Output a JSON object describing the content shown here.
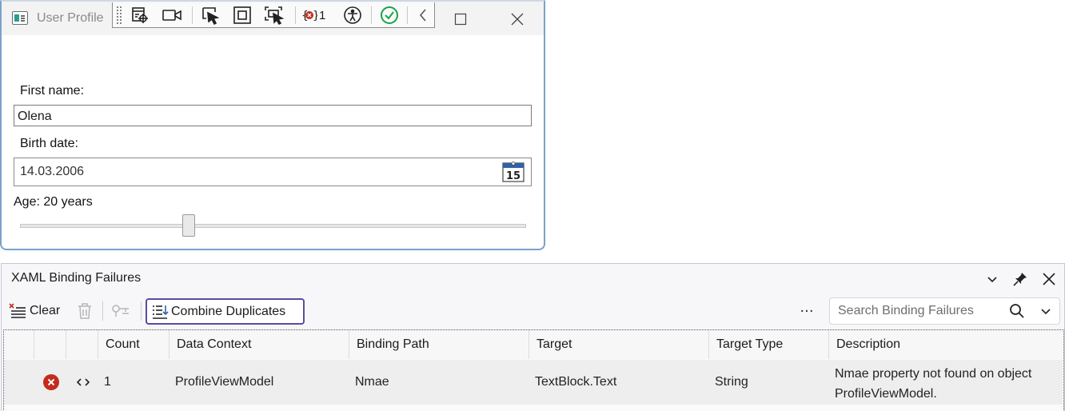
{
  "app_window": {
    "title": "User Profile",
    "runtime_toolbar": {
      "error_count": "1",
      "tools": [
        "go-to-live-visual-tree",
        "show-in-app-toolbar",
        "select-element",
        "display-layout-adorners",
        "track-focused-element",
        "binding-failures",
        "accessibility-checker",
        "hot-reload-status",
        "collapse-toolbar"
      ]
    },
    "form": {
      "first_name_label": "First name:",
      "first_name_value": "Olena",
      "birth_date_label": "Birth date:",
      "birth_date_value": "14.03.2006",
      "calendar_day": "15",
      "age_label": "Age: 20 years",
      "age_slider_fraction": 0.333
    }
  },
  "panel": {
    "title": "XAML Binding Failures",
    "toolbar": {
      "clear_label": "Clear",
      "combine_label": "Combine Duplicates",
      "more_label": "···",
      "search_placeholder": "Search Binding Failures"
    },
    "columns": [
      "Count",
      "Data Context",
      "Binding Path",
      "Target",
      "Target Type",
      "Description"
    ],
    "rows": [
      {
        "count": "1",
        "data_context": "ProfileViewModel",
        "binding_path": "Nmae",
        "target": "TextBlock.Text",
        "target_type": "String",
        "description": "Nmae property not found on object ProfileViewModel."
      }
    ]
  },
  "colors": {
    "accent": "#5a4da0",
    "error": "#c42b1c",
    "success": "#16a34a",
    "window_border": "#7aa1cc"
  }
}
